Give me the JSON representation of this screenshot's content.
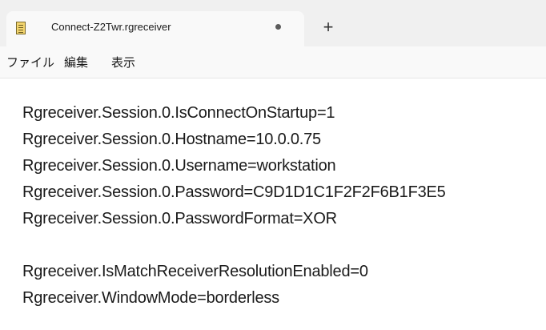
{
  "tab": {
    "title": "Connect-Z2Twr.rgreceiver",
    "icon": "notepad-file-icon",
    "unsaved_indicator": "dot-icon"
  },
  "new_tab": {
    "label": "+"
  },
  "menu": {
    "items": [
      {
        "label": "ファイル"
      },
      {
        "label": "編集"
      },
      {
        "label": "表示"
      }
    ]
  },
  "editor": {
    "lines": [
      "Rgreceiver.Session.0.IsConnectOnStartup=1",
      "Rgreceiver.Session.0.Hostname=10.0.0.75",
      "Rgreceiver.Session.0.Username=workstation",
      "Rgreceiver.Session.0.Password=C9D1D1C1F2F2F6B1F3E5",
      "Rgreceiver.Session.0.PasswordFormat=XOR",
      "",
      "Rgreceiver.IsMatchReceiverResolutionEnabled=0",
      "Rgreceiver.WindowMode=borderless"
    ]
  }
}
